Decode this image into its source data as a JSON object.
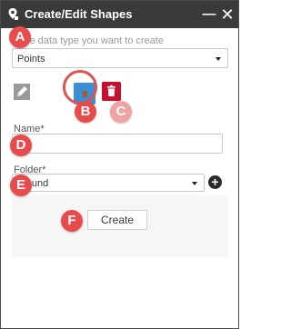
{
  "window": {
    "title": "Create/Edit Shapes",
    "minimize_label": "—",
    "close_label": "✕",
    "icon": "map-pin-icon"
  },
  "datatype": {
    "prompt": "S",
    "prompt_rest": " the data type you want to create",
    "selected": "Points"
  },
  "toolbar": {
    "edit_icon": "edit-shape-icon",
    "draw_icon": "draw-point-icon",
    "delete_icon": "trash-icon"
  },
  "form": {
    "name_label": "Name*",
    "name_value": "",
    "folder_label": "Folder*",
    "folder_selected": "ground",
    "add_folder_label": "+",
    "create_label": "Create"
  },
  "markers": [
    "A",
    "B",
    "C",
    "D",
    "E",
    "F"
  ],
  "colors": {
    "titlebar": "#3a3a3a",
    "draw_button": "#3b8fd4",
    "delete_button": "#c8102e",
    "marker": "#e84b4b"
  }
}
